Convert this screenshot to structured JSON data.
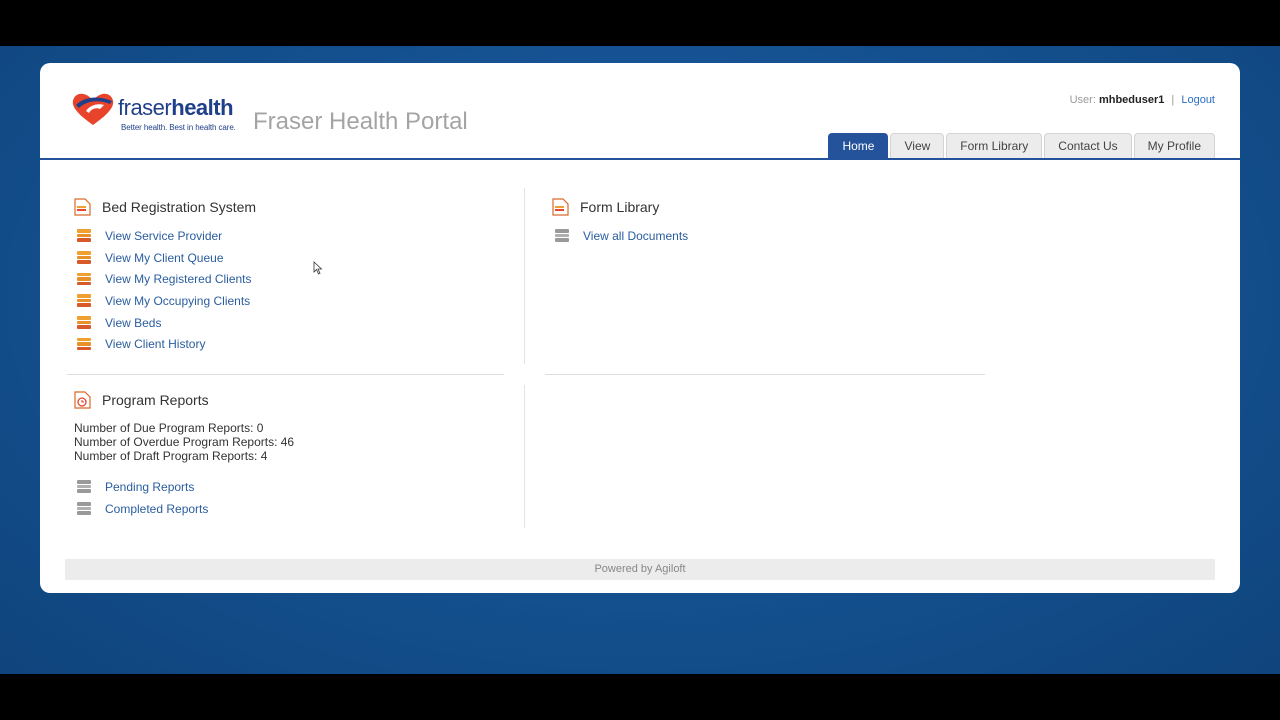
{
  "portal": {
    "title": "Fraser Health Portal",
    "logo": {
      "brand_light": "fraser",
      "brand_bold": "health",
      "tagline": "Better health. Best in health care."
    }
  },
  "userbar": {
    "user_label": "User:",
    "username": "mhbeduser1",
    "separator": "|",
    "logout": "Logout"
  },
  "tabs": [
    {
      "label": "Home",
      "active": true
    },
    {
      "label": "View"
    },
    {
      "label": "Form Library"
    },
    {
      "label": "Contact Us"
    },
    {
      "label": "My Profile"
    }
  ],
  "bed_registration": {
    "title": "Bed Registration System",
    "links": [
      "View Service Provider",
      "View My Client Queue",
      "View My Registered Clients",
      "View My Occupying Clients",
      "View Beds",
      "View Client History"
    ]
  },
  "form_library": {
    "title": "Form Library",
    "links": [
      "View all Documents"
    ]
  },
  "program_reports": {
    "title": "Program Reports",
    "stats": [
      "Number of Due Program Reports: 0",
      "Number of Overdue Program Reports: 46",
      "Number of Draft Program Reports: 4"
    ],
    "links": [
      "Pending Reports",
      "Completed Reports"
    ]
  },
  "footer": {
    "text": "Powered by Agiloft"
  },
  "colors": {
    "accent": "#24539b",
    "link": "#2a5d9f",
    "background": "#14508f"
  }
}
